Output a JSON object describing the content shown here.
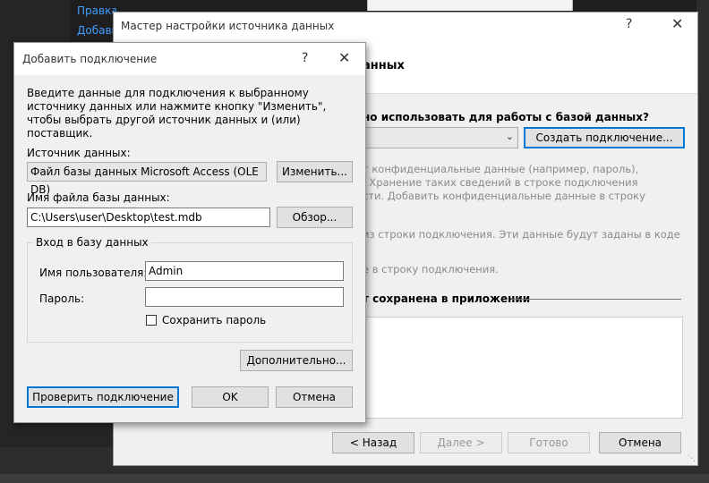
{
  "ide": {
    "link1": "Правка сведений",
    "link2": "Добавить"
  },
  "wizard": {
    "title": "Мастер настройки источника данных",
    "help_icon": "?",
    "close_icon": "✕",
    "header_title": "анных",
    "question": "но использовать для работы с базой данных?",
    "create_connection": "Создать подключение...",
    "gray_line1": "т конфиденциальные данные (например, пароль),",
    "gray_line2": ". Хранение таких сведений в строке подключения",
    "gray_line3": "сти. Добавить конфиденциальные данные в строку",
    "gray_line4": "из строки подключения. Эти данные будут заданы в коде",
    "gray_line5": "е в строку подключения.",
    "save_section": "т сохранена в приложении",
    "buttons": {
      "back": "< Назад",
      "next": "Далее >",
      "finish": "Готово",
      "cancel": "Отмена"
    }
  },
  "dialog": {
    "title": "Добавить подключение",
    "help_icon": "?",
    "close_icon": "✕",
    "intro": "Введите данные для подключения к выбранному источнику данных или нажмите кнопку \"Изменить\", чтобы выбрать другой источник данных и (или) поставщик.",
    "datasource_label": "Источник данных:",
    "datasource_value": "Файл базы данных Microsoft Access (OLE DB)",
    "change_button": "Изменить...",
    "filename_label": "Имя файла базы данных:",
    "filename_value": "C:\\Users\\user\\Desktop\\test.mdb",
    "browse_button": "Обзор...",
    "login_group": "Вход в базу данных",
    "username_label": "Имя пользователя:",
    "username_value": "Admin",
    "password_label": "Пароль:",
    "password_value": "",
    "save_password": "Сохранить пароль",
    "advanced_button": "Дополнительно...",
    "test_button": "Проверить подключение",
    "ok_button": "OK",
    "cancel_button": "Отмена"
  },
  "colors": {
    "accent": "#0078d7",
    "link": "#3f9bff",
    "ide_bg": "#1e1e1e"
  }
}
